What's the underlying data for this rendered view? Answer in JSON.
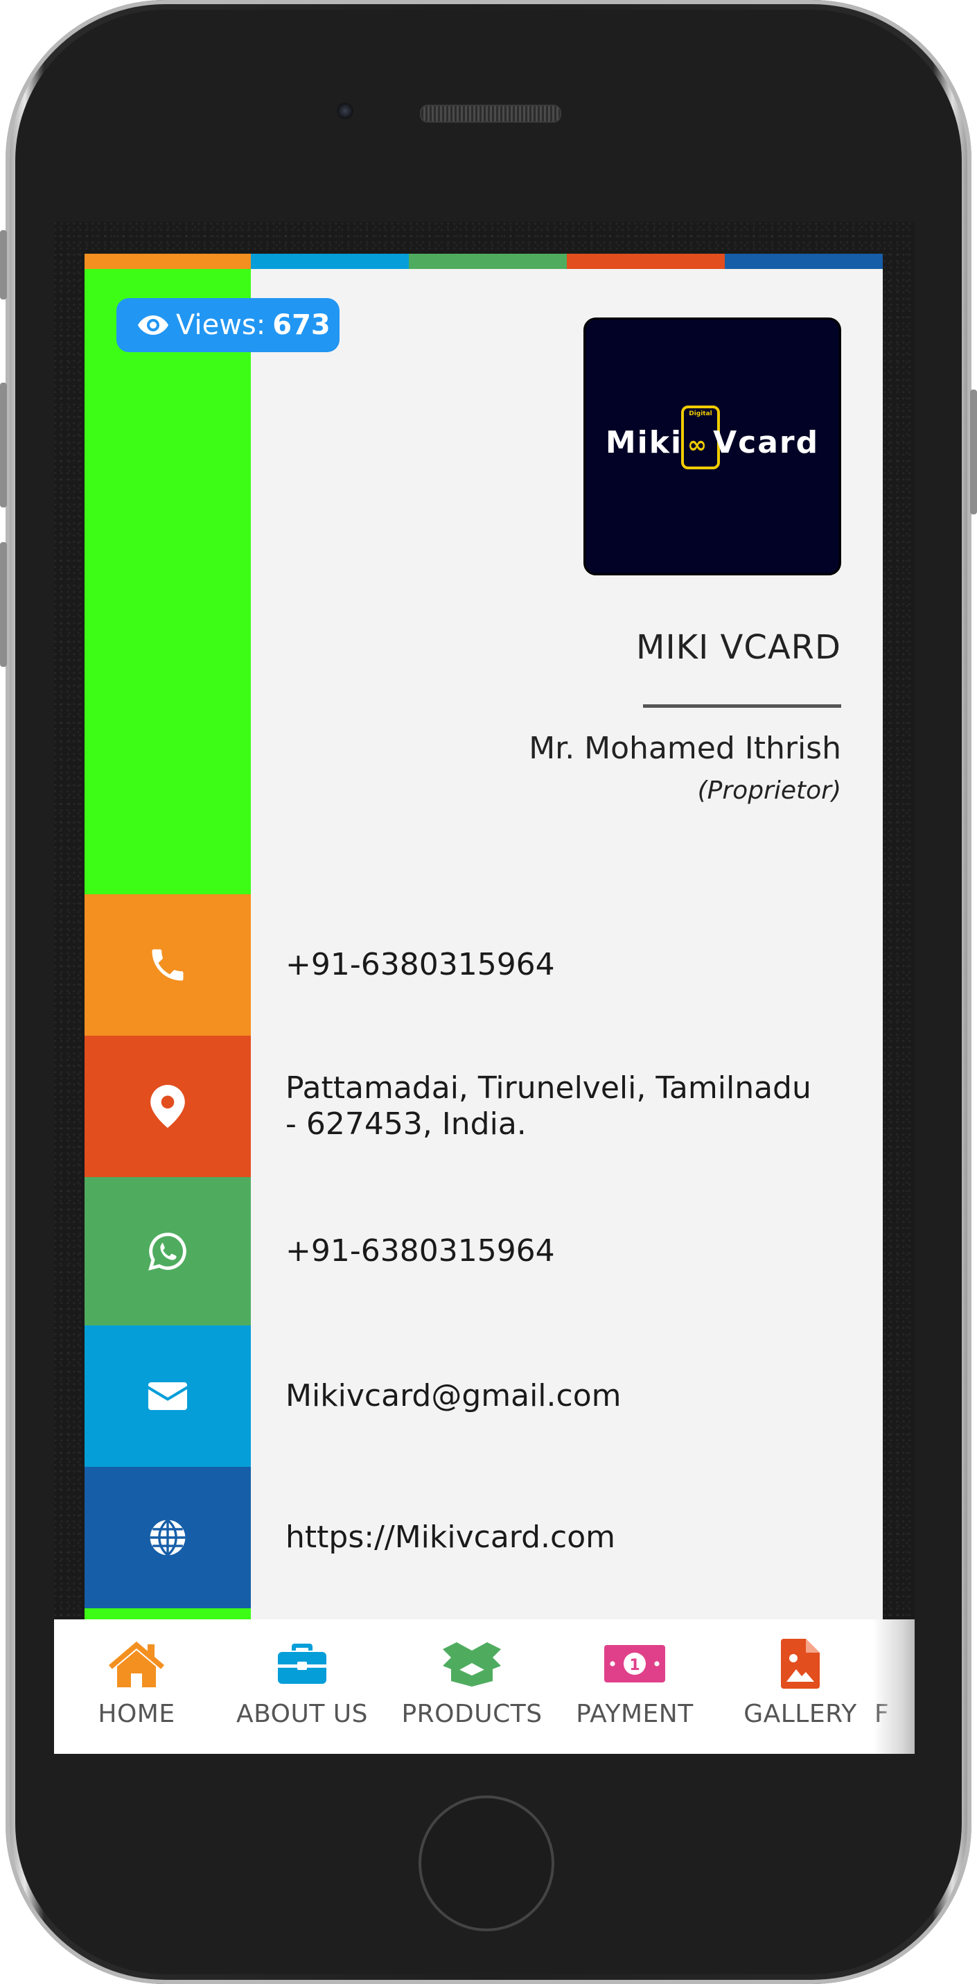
{
  "views": {
    "label": "Views:",
    "count": "673"
  },
  "logo": {
    "text_left": "Miki",
    "text_right": "Vcard",
    "tag": "Digital"
  },
  "profile": {
    "company": "MIKI VCARD",
    "person": "Mr. Mohamed Ithrish",
    "role": "(Proprietor)"
  },
  "contacts": [
    {
      "icon": "phone-icon",
      "text": "+91-6380315964",
      "color": "#f39020"
    },
    {
      "icon": "location-pin-icon",
      "text": "Pattamadai, Tirunelveli, Tamilnadu - 627453, India.",
      "color": "#e24e1e"
    },
    {
      "icon": "whatsapp-icon",
      "text": "+91-6380315964",
      "color": "#4fac5f"
    },
    {
      "icon": "envelope-icon",
      "text": "Mikivcard@gmail.com",
      "color": "#059ed9"
    },
    {
      "icon": "globe-icon",
      "text": "https://Mikivcard.com",
      "color": "#165ea8"
    }
  ],
  "stripes": [
    "#f39020",
    "#059ed9",
    "#4fac5f",
    "#e24e1e",
    "#165ea8"
  ],
  "nav": [
    {
      "label": "HOME",
      "icon": "home-icon",
      "color": "#f39020"
    },
    {
      "label": "ABOUT US",
      "icon": "briefcase-icon",
      "color": "#059ed9"
    },
    {
      "label": "PRODUCTS",
      "icon": "open-box-icon",
      "color": "#4fac5f"
    },
    {
      "label": "PAYMENT",
      "icon": "money-icon",
      "color": "#e0408a"
    },
    {
      "label": "GALLERY",
      "icon": "image-file-icon",
      "color": "#e24e1e"
    },
    {
      "label": "F",
      "icon": "",
      "color": "#555555"
    }
  ]
}
